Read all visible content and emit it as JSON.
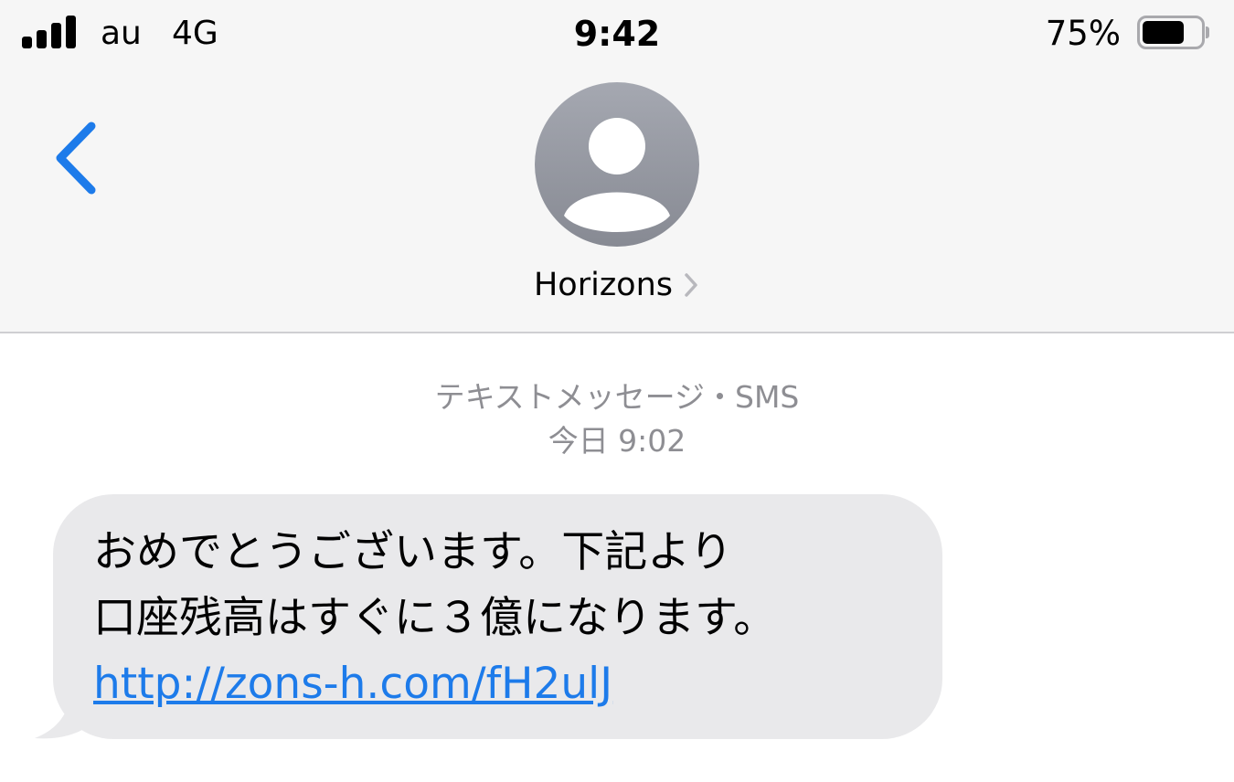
{
  "status_bar": {
    "carrier": "au",
    "network": "4G",
    "time": "9:42",
    "battery_percent": "75%",
    "battery_level": 0.75,
    "signal_bars": 4
  },
  "nav": {
    "back_icon": "chevron-left-icon",
    "avatar_icon": "person-icon",
    "contact_name": "Horizons",
    "contact_chevron_icon": "chevron-right-icon"
  },
  "conversation": {
    "message_type": "テキストメッセージ・SMS",
    "timestamp": "今日 9:02",
    "messages": [
      {
        "direction": "incoming",
        "lines": [
          "おめでとうございます。下記より",
          "口座残高はすぐに３億になります。"
        ],
        "link": "http://zons-h.com/fH2ulJ"
      }
    ]
  },
  "colors": {
    "accent": "#1d7bea",
    "header_background": "#f6f6f6",
    "incoming_bubble": "#e9e9eb",
    "secondary_text": "#8e8e93"
  }
}
